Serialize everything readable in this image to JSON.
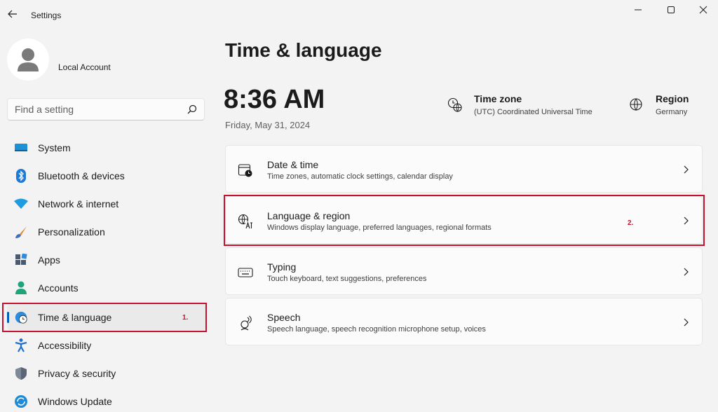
{
  "window": {
    "title": "Settings",
    "controls": [
      "minimize-icon",
      "maximize-icon",
      "close-icon"
    ]
  },
  "account": {
    "name": "Local Account"
  },
  "search": {
    "placeholder": "Find a setting",
    "value": ""
  },
  "sidebar": {
    "items": [
      {
        "label": "System",
        "icon": "system-icon"
      },
      {
        "label": "Bluetooth & devices",
        "icon": "bluetooth-icon"
      },
      {
        "label": "Network & internet",
        "icon": "wifi-icon"
      },
      {
        "label": "Personalization",
        "icon": "brush-icon"
      },
      {
        "label": "Apps",
        "icon": "apps-icon"
      },
      {
        "label": "Accounts",
        "icon": "accounts-icon"
      },
      {
        "label": "Time & language",
        "icon": "time-language-icon",
        "active": true
      },
      {
        "label": "Accessibility",
        "icon": "accessibility-icon"
      },
      {
        "label": "Privacy & security",
        "icon": "shield-icon"
      },
      {
        "label": "Windows Update",
        "icon": "update-icon"
      }
    ]
  },
  "annotations": {
    "step1": "1.",
    "step2": "2.",
    "highlight_color": "#c8102e"
  },
  "main": {
    "title": "Time & language",
    "time": "8:36 AM",
    "date": "Friday, May 31, 2024",
    "time_zone": {
      "title": "Time zone",
      "value": "(UTC) Coordinated Universal Time"
    },
    "region": {
      "title": "Region",
      "value": "Germany"
    },
    "cards": [
      {
        "title": "Date & time",
        "subtitle": "Time zones, automatic clock settings, calendar display",
        "icon": "calendar-clock-icon"
      },
      {
        "title": "Language & region",
        "subtitle": "Windows display language, preferred languages, regional formats",
        "icon": "language-icon"
      },
      {
        "title": "Typing",
        "subtitle": "Touch keyboard, text suggestions, preferences",
        "icon": "keyboard-icon"
      },
      {
        "title": "Speech",
        "subtitle": "Speech language, speech recognition microphone setup, voices",
        "icon": "speech-icon"
      }
    ]
  },
  "colors": {
    "accent": "#005fb8",
    "background": "#f3f3f3",
    "card": "#fbfbfb"
  }
}
